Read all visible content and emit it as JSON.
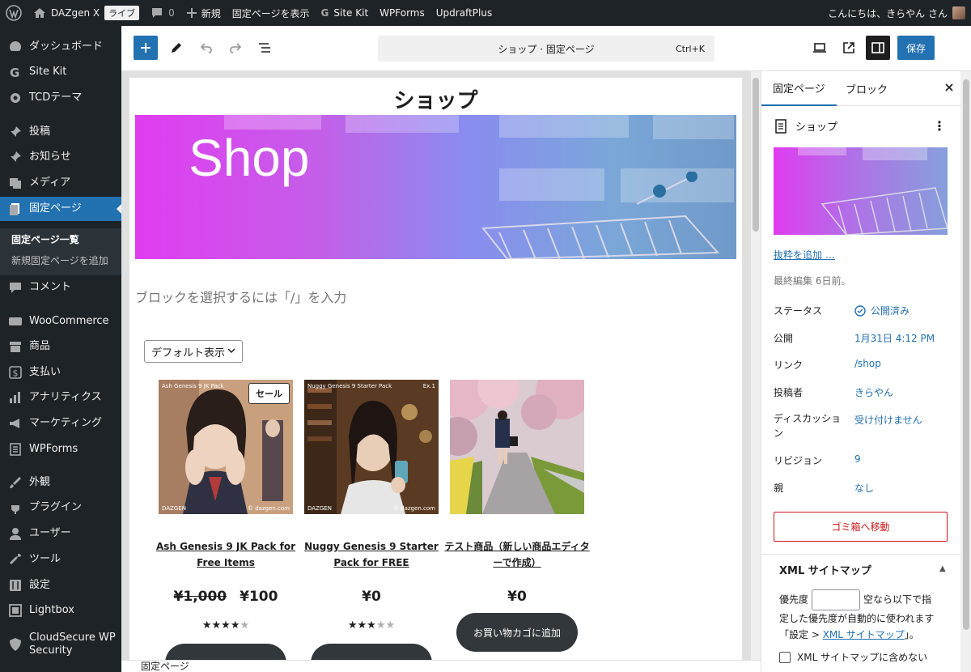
{
  "adminbar": {
    "site_name": "DAZgen X",
    "live_label": "ライブ",
    "comments_count": "0",
    "new_label": "新規",
    "view_page": "固定ページを表示",
    "site_kit": "Site Kit",
    "wpforms": "WPForms",
    "updraft": "UpdraftPlus",
    "greeting": "こんにちは、きらやん さん"
  },
  "sidebar": {
    "items": [
      {
        "label": "ダッシュボード",
        "icon": "dashboard-icon"
      },
      {
        "label": "Site Kit",
        "icon": "google-g-icon"
      },
      {
        "label": "TCDテーマ",
        "icon": "gear-icon"
      },
      {
        "label": "投稿",
        "icon": "pin-icon"
      },
      {
        "label": "お知らせ",
        "icon": "pin-icon"
      },
      {
        "label": "メディア",
        "icon": "media-icon"
      },
      {
        "label": "固定ページ",
        "icon": "pages-icon"
      },
      {
        "label": "コメント",
        "icon": "comment-icon"
      },
      {
        "label": "WooCommerce",
        "icon": "woo-icon"
      },
      {
        "label": "商品",
        "icon": "archive-icon"
      },
      {
        "label": "支払い",
        "icon": "dollar-icon"
      },
      {
        "label": "アナリティクス",
        "icon": "chart-icon"
      },
      {
        "label": "マーケティング",
        "icon": "megaphone-icon"
      },
      {
        "label": "WPForms",
        "icon": "form-icon"
      },
      {
        "label": "外観",
        "icon": "brush-icon"
      },
      {
        "label": "プラグイン",
        "icon": "plugin-icon"
      },
      {
        "label": "ユーザー",
        "icon": "user-icon"
      },
      {
        "label": "ツール",
        "icon": "wrench-icon"
      },
      {
        "label": "設定",
        "icon": "settings-icon"
      },
      {
        "label": "Lightbox",
        "icon": "lightbox-icon"
      },
      {
        "label": "CloudSecure WP\nSecurity",
        "icon": "shield-icon"
      }
    ],
    "submenu": {
      "current": "固定ページ一覧",
      "add_new": "新規固定ページを追加"
    }
  },
  "toolbar": {
    "doc_title": "ショップ · 固定ページ",
    "shortcut": "Ctrl+K",
    "save_label": "保存"
  },
  "canvas": {
    "page_title": "ショップ",
    "hero_text": "Shop",
    "block_placeholder": "ブロックを選択するには「/」を入力",
    "orderby": "デフォルト表示",
    "products": [
      {
        "title": "Ash Genesis 9 JK Pack for Free Items",
        "old_price": "¥1,000",
        "price": "¥100",
        "sale": "セール",
        "rating": 4,
        "img_caption": "Ash Genesis 9 JK Pack"
      },
      {
        "title": "Nuggy Genesis 9 Starter Pack for FREE",
        "price": "¥0",
        "rating": 3,
        "img_caption": "Nuggy Genesis 9 Starter Pack",
        "img_tag": "Ex.1"
      },
      {
        "title": "テスト商品（新しい商品エディターで作成）",
        "price": "¥0",
        "cart_button": "お買い物カゴに追加"
      }
    ],
    "img_brand": "DAZGEN",
    "img_copy": "© dazgen.com"
  },
  "footer": {
    "breadcrumb": "固定ページ"
  },
  "panel": {
    "tab_page": "固定ページ",
    "tab_block": "ブロック",
    "doc_name": "ショップ",
    "excerpt_link": "抜粋を追加 …",
    "last_edited": "最終編集 6日前。",
    "meta": [
      {
        "label": "ステータス",
        "value": "公開済み"
      },
      {
        "label": "公開",
        "value": "1月31日 4:12 PM"
      },
      {
        "label": "リンク",
        "value": "/shop"
      },
      {
        "label": "投稿者",
        "value": "きらやん"
      },
      {
        "label": "ディスカッション",
        "value": "受け付けません"
      },
      {
        "label": "リビジョン",
        "value": "9"
      },
      {
        "label": "親",
        "value": "なし"
      }
    ],
    "trash": "ゴミ箱へ移動",
    "xml_title": "XML サイトマップ",
    "xml_prio_label": "優先度",
    "xml_text": "空なら以下で指定した優先度が自動的に使われます",
    "xml_text_prefix": "「設定 > ",
    "xml_link": "XML サイトマップ",
    "xml_text_suffix": "」。",
    "xml_exclude": "XML サイトマップに含めない"
  },
  "colors": {
    "accent": "#2271b1",
    "admin_dark": "#1d2327",
    "danger": "#cc1818"
  }
}
